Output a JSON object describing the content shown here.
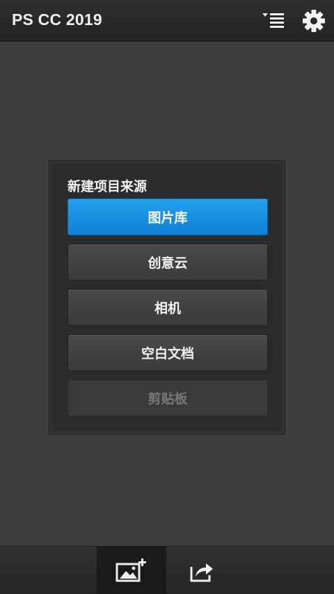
{
  "header": {
    "app_title": "PS CC 2019",
    "icons": [
      "list-menu-icon",
      "gear-icon"
    ]
  },
  "dialog": {
    "title": "新建项目来源",
    "options": [
      {
        "label": "图片库",
        "state": "selected"
      },
      {
        "label": "创意云",
        "state": "normal"
      },
      {
        "label": "相机",
        "state": "normal"
      },
      {
        "label": "空白文档",
        "state": "normal"
      },
      {
        "label": "剪贴板",
        "state": "disabled"
      }
    ]
  },
  "bottom_bar": {
    "icons": [
      "add-image-icon",
      "share-icon"
    ]
  },
  "colors": {
    "accent": "#1a8fe0",
    "background": "#3d3d3d",
    "bar": "#2a2a2a"
  }
}
